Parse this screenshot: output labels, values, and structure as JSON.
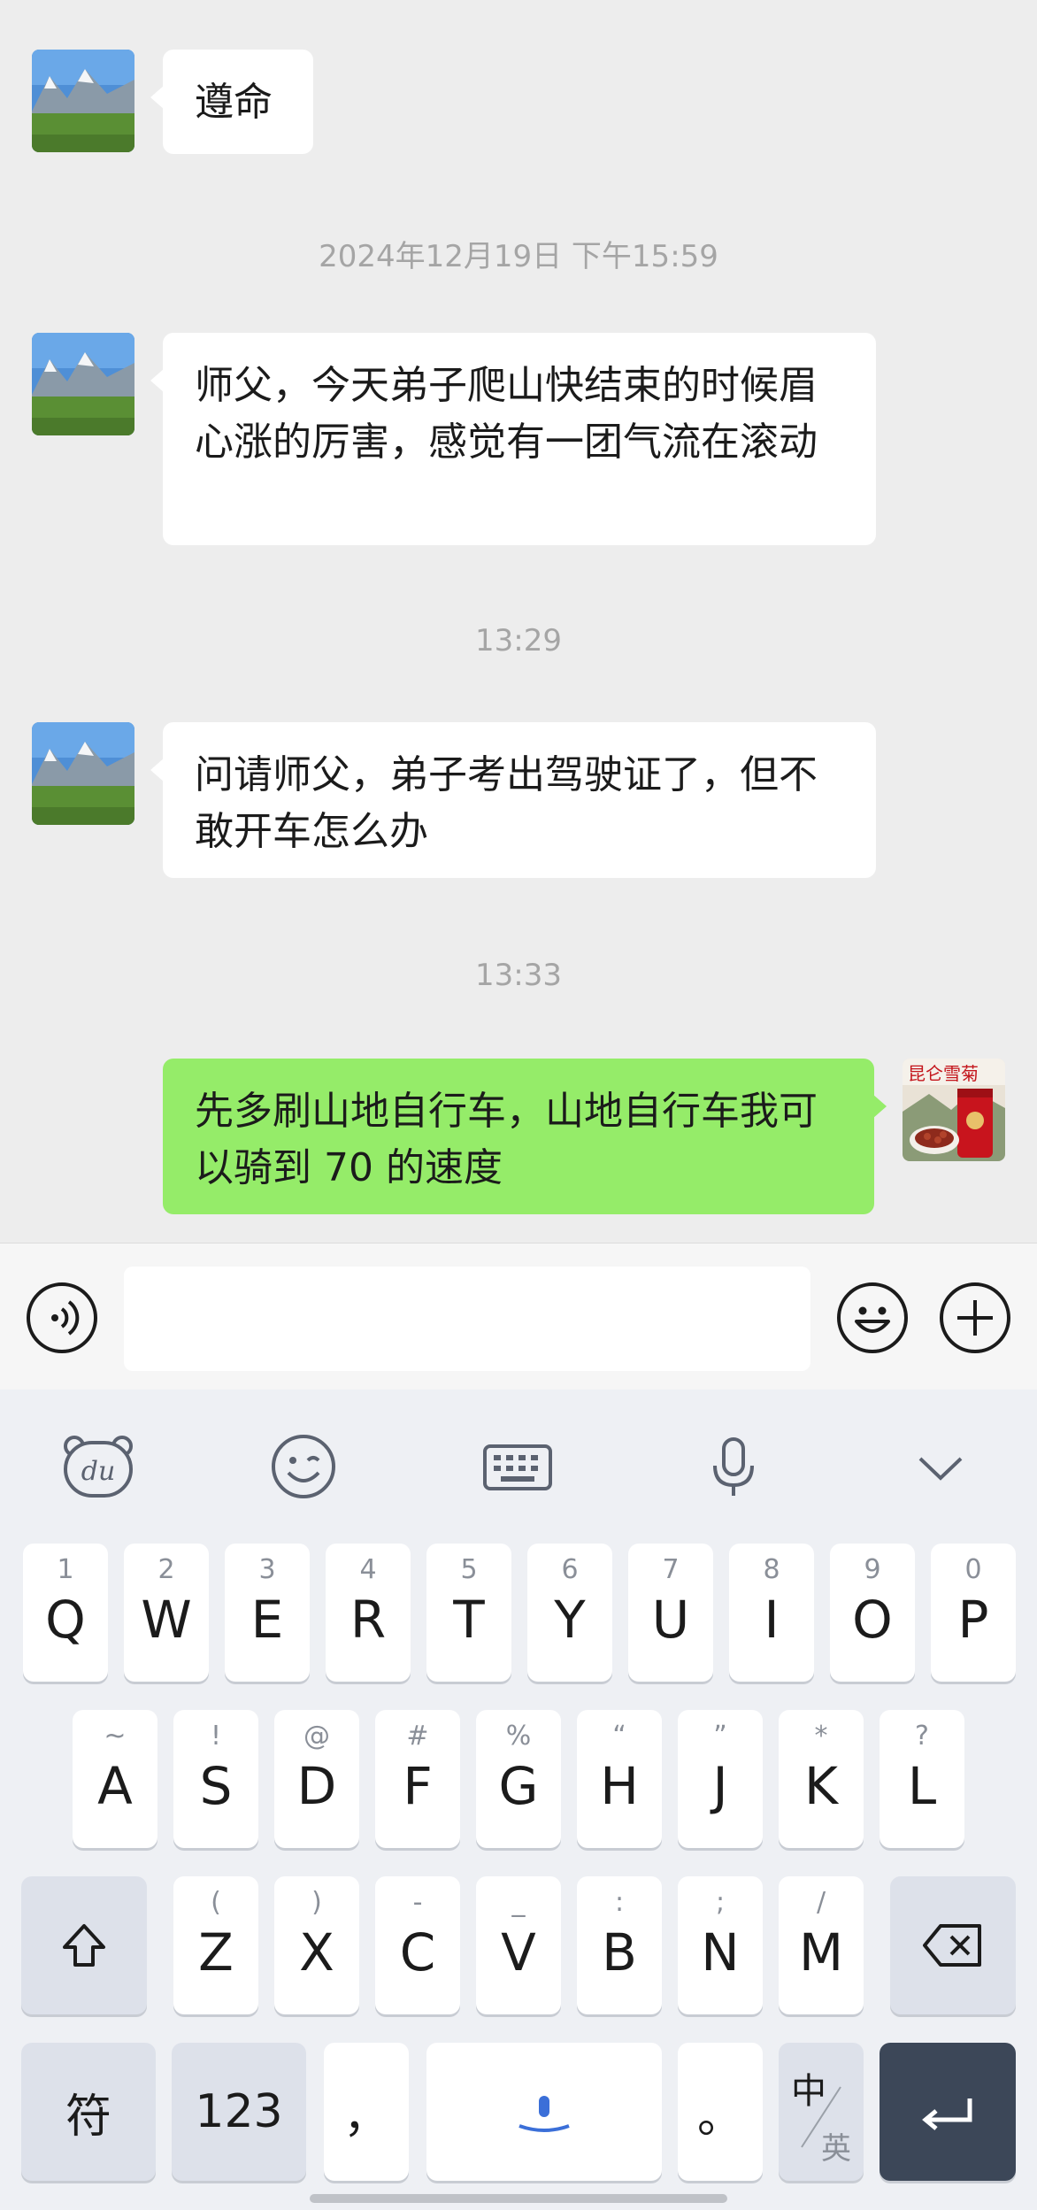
{
  "chat": {
    "messages": [
      {
        "side": "in",
        "text": "遵命"
      },
      {
        "side": "in",
        "text": "师父，今天弟子爬山快结束的时候眉心涨的厉害，感觉有一团气流在滚动"
      },
      {
        "side": "in",
        "text": "问请师父，弟子考出驾驶证了，但不敢开车怎么办"
      },
      {
        "side": "out",
        "text": "先多刷山地自行车，山地自行车我可以骑到 70 的速度"
      }
    ],
    "timestamps": [
      "2024年12月19日 下午15:59",
      "13:29",
      "13:33"
    ],
    "self_avatar_text": "昆仑雪菊",
    "bubble_in_color": "#ffffff",
    "bubble_out_color": "#95ec69"
  },
  "input_bar": {
    "voice_icon": "voice-icon",
    "emoji_icon": "emoji-icon",
    "plus_icon": "plus-icon",
    "message_value": ""
  },
  "keyboard": {
    "toolbar": [
      "du-bear-icon",
      "smiley-icon",
      "keyboard-icon",
      "microphone-icon",
      "chevron-down-icon"
    ],
    "row1": [
      {
        "main": "Q",
        "sub": "1"
      },
      {
        "main": "W",
        "sub": "2"
      },
      {
        "main": "E",
        "sub": "3"
      },
      {
        "main": "R",
        "sub": "4"
      },
      {
        "main": "T",
        "sub": "5"
      },
      {
        "main": "Y",
        "sub": "6"
      },
      {
        "main": "U",
        "sub": "7"
      },
      {
        "main": "I",
        "sub": "8"
      },
      {
        "main": "O",
        "sub": "9"
      },
      {
        "main": "P",
        "sub": "0"
      }
    ],
    "row2": [
      {
        "main": "A",
        "sub": "~"
      },
      {
        "main": "S",
        "sub": "!"
      },
      {
        "main": "D",
        "sub": "@"
      },
      {
        "main": "F",
        "sub": "#"
      },
      {
        "main": "G",
        "sub": "%"
      },
      {
        "main": "H",
        "sub": "“"
      },
      {
        "main": "J",
        "sub": "”"
      },
      {
        "main": "K",
        "sub": "*"
      },
      {
        "main": "L",
        "sub": "?"
      }
    ],
    "row3": [
      {
        "main": "Z",
        "sub": "("
      },
      {
        "main": "X",
        "sub": ")"
      },
      {
        "main": "C",
        "sub": "-"
      },
      {
        "main": "V",
        "sub": "_"
      },
      {
        "main": "B",
        "sub": ":"
      },
      {
        "main": "N",
        "sub": ";"
      },
      {
        "main": "M",
        "sub": "/"
      }
    ],
    "bottom": {
      "symbols": "符",
      "numbers": "123",
      "comma": "，",
      "period": "。",
      "lang_top": "中",
      "lang_bottom": "英"
    }
  }
}
